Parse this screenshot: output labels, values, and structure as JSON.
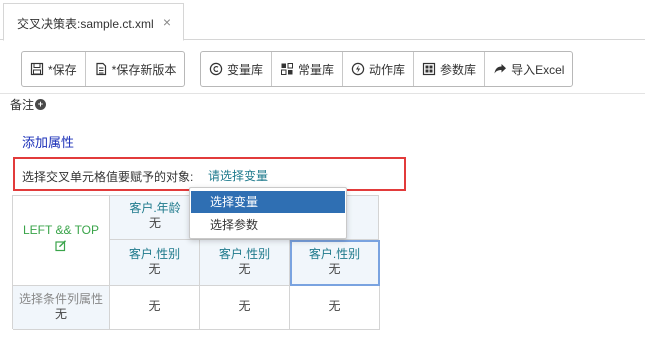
{
  "tab": {
    "title": "交叉决策表:sample.ct.xml",
    "close": "×"
  },
  "toolbar": {
    "save": "*保存",
    "save_new_version": "*保存新版本",
    "variable_lib": "变量库",
    "constant_lib": "常量库",
    "action_lib": "动作库",
    "parameter_lib": "参数库",
    "import_excel": "导入Excel"
  },
  "note": {
    "label": "备注",
    "plus": "+"
  },
  "add_attribute": "添加属性",
  "assign": {
    "label": "选择交叉单元格值要赋予的对象:",
    "link": "请选择变量"
  },
  "dropdown": {
    "items": [
      "选择变量",
      "选择参数"
    ],
    "active_index": 0
  },
  "grid": {
    "corner": "LEFT && TOP",
    "top_header": {
      "title": "客户.年龄",
      "value": "无"
    },
    "sub_headers": [
      {
        "title": "客户.性别",
        "value": "无"
      },
      {
        "title": "客户.性别",
        "value": "无"
      },
      {
        "title": "客户.性别",
        "value": "无"
      }
    ],
    "row_header": {
      "title": "选择条件列属性",
      "value": "无"
    },
    "cells": [
      "无",
      "无",
      "无"
    ]
  },
  "colors": {
    "accent": "#2f6fb3",
    "highlight_border": "#e23b3b",
    "link": "#1a2fb8",
    "teal": "#1e7a8c",
    "green": "#3aa44a"
  }
}
